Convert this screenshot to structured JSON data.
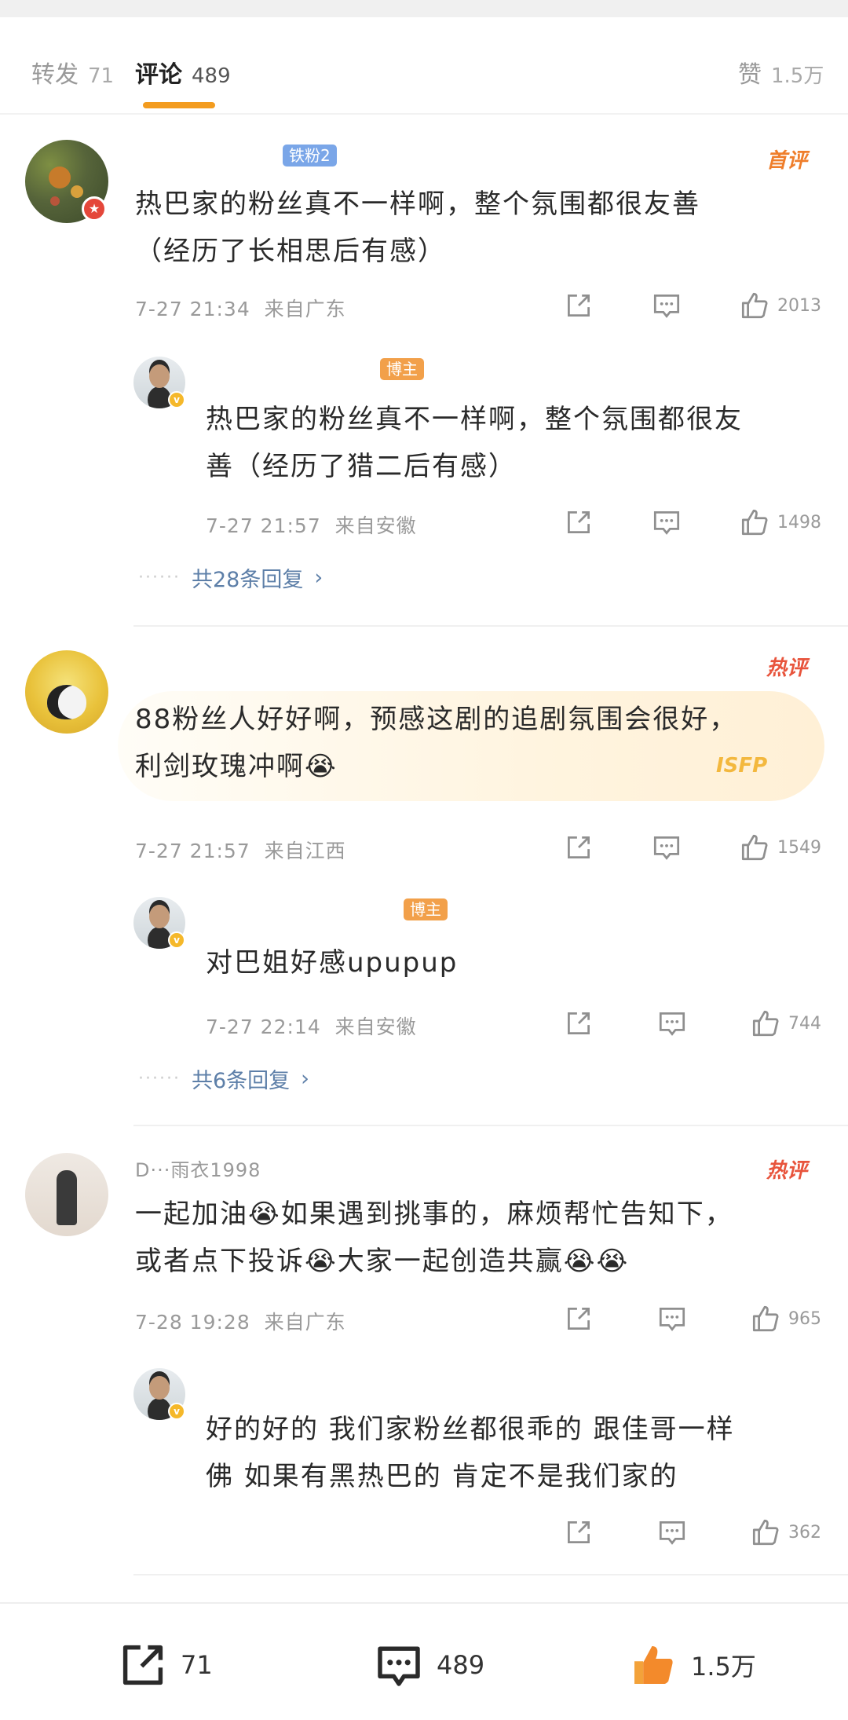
{
  "tabs": [
    {
      "label": "转发",
      "count": "71"
    },
    {
      "label": "评论",
      "count": "489"
    }
  ],
  "likes_tab": {
    "label": "赞",
    "count": "1.5万"
  },
  "comments": [
    {
      "tag": "铁粉2",
      "rank": "首评",
      "text_line1": "热巴家的粉丝真不一样啊，整个氛围都很友善",
      "text_line2": "（经历了长相思后有感）",
      "time": "7-27 21:34",
      "location": "来自广东",
      "likes": "2013",
      "reply": {
        "tag": "博主",
        "text_line1": "热巴家的粉丝真不一样啊，整个氛围都很友",
        "text_line2": "善（经历了猎二后有感）",
        "time": "7-27 21:57",
        "location": "来自安徽",
        "likes": "1498"
      },
      "more_replies": "共28条回复"
    },
    {
      "rank": "热评",
      "text_line1": "88粉丝人好好啊，预感这剧的追剧氛围会很好，",
      "text_line2": "利剑玫瑰冲啊😭",
      "decoration": "ISFP",
      "time": "7-27 21:57",
      "location": "来自江西",
      "likes": "1549",
      "reply": {
        "tag": "博主",
        "text_line1": "对巴姐好感upupup",
        "time": "7-27 22:14",
        "location": "来自安徽",
        "likes": "744"
      },
      "more_replies": "共6条回复"
    },
    {
      "username": "D···雨衣1998",
      "rank": "热评",
      "text_line1": "一起加油😭如果遇到挑事的，麻烦帮忙告知下，",
      "text_line2": "或者点下投诉😭大家一起创造共赢😭😭",
      "time": "7-28 19:28",
      "location": "来自广东",
      "likes": "965",
      "reply": {
        "text_line1": "好的好的 我们家粉丝都很乖的 跟佳哥一样",
        "text_line2": "佛 如果有黑热巴的 肯定不是我们家的",
        "likes": "362"
      }
    }
  ],
  "bottom_bar": {
    "repost": "71",
    "comment": "489",
    "like": "1.5万"
  },
  "colors": {
    "accent": "#f39c1f",
    "link": "#5d7fa8",
    "hot": "#e8543c"
  }
}
